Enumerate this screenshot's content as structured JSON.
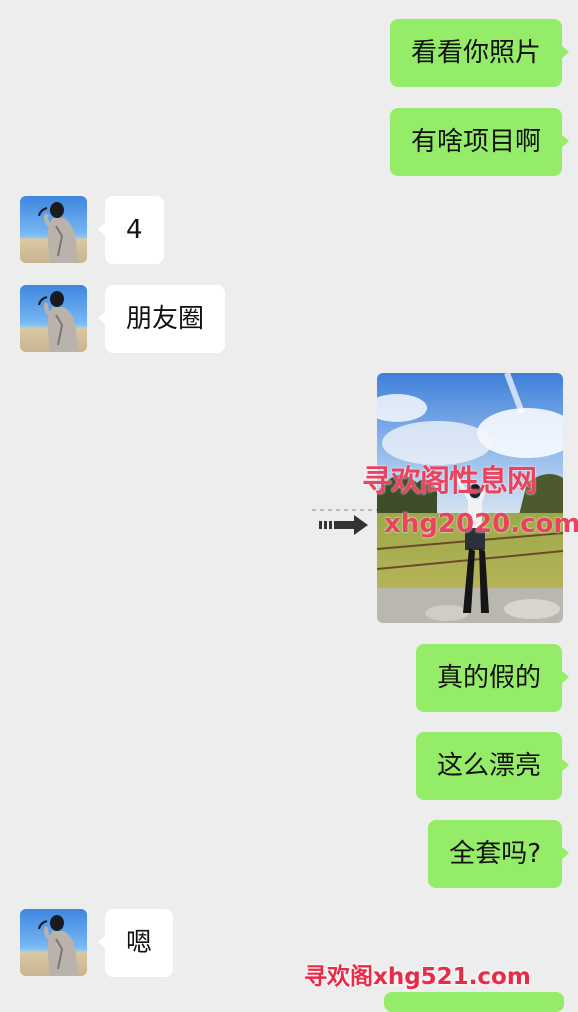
{
  "chat": {
    "messages": [
      {
        "direction": "outgoing",
        "type": "text",
        "text": "看看你照片"
      },
      {
        "direction": "outgoing",
        "type": "text",
        "text": "有啥项目啊"
      },
      {
        "direction": "incoming",
        "type": "text",
        "text": "4"
      },
      {
        "direction": "incoming",
        "type": "text",
        "text": "朋友圈"
      },
      {
        "direction": "outgoing",
        "type": "image"
      },
      {
        "direction": "outgoing",
        "type": "text",
        "text": "真的假的"
      },
      {
        "direction": "outgoing",
        "type": "text",
        "text": "这么漂亮"
      },
      {
        "direction": "outgoing",
        "type": "text",
        "text": "全套吗?"
      },
      {
        "direction": "incoming",
        "type": "text",
        "text": "嗯"
      }
    ]
  },
  "watermarks": {
    "overlay_cn": "寻欢阁性息网",
    "overlay_url": "xhg2020.com",
    "footer": "寻欢阁xhg521.com"
  },
  "colors": {
    "background": "#ededed",
    "outgoing_bubble": "#95ec69",
    "incoming_bubble": "#ffffff",
    "watermark": "#e9435f"
  },
  "icons": {
    "avatar": "contact-avatar",
    "forward": "forward-arrow-icon"
  }
}
